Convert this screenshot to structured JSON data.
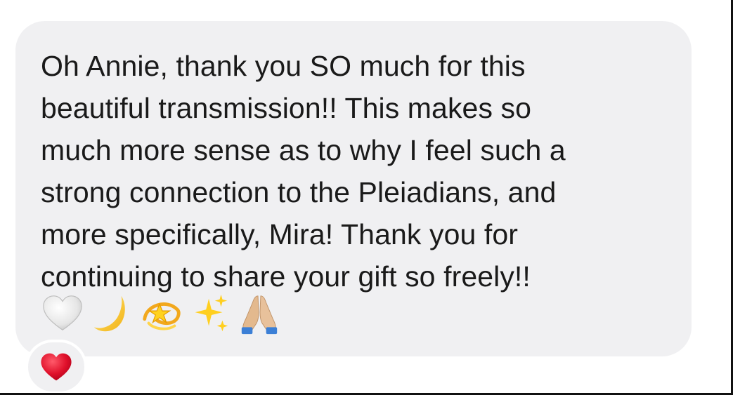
{
  "message": {
    "text": "Oh Annie, thank you SO much for this\nbeautiful transmission!! This makes so\nmuch more sense as to why I feel such a\nstrong connection to the Pleiadians, and\nmore specifically, Mira! Thank you for\ncontinuing to share your gift so freely!!",
    "emojis": [
      "white-heart",
      "crescent-moon",
      "dizzy",
      "sparkles",
      "folded-hands"
    ]
  },
  "reaction": {
    "emoji": "red-heart",
    "color": "#e0112b"
  },
  "colors": {
    "bubble_background": "#f0f0f2",
    "text": "#1a1a1a"
  }
}
